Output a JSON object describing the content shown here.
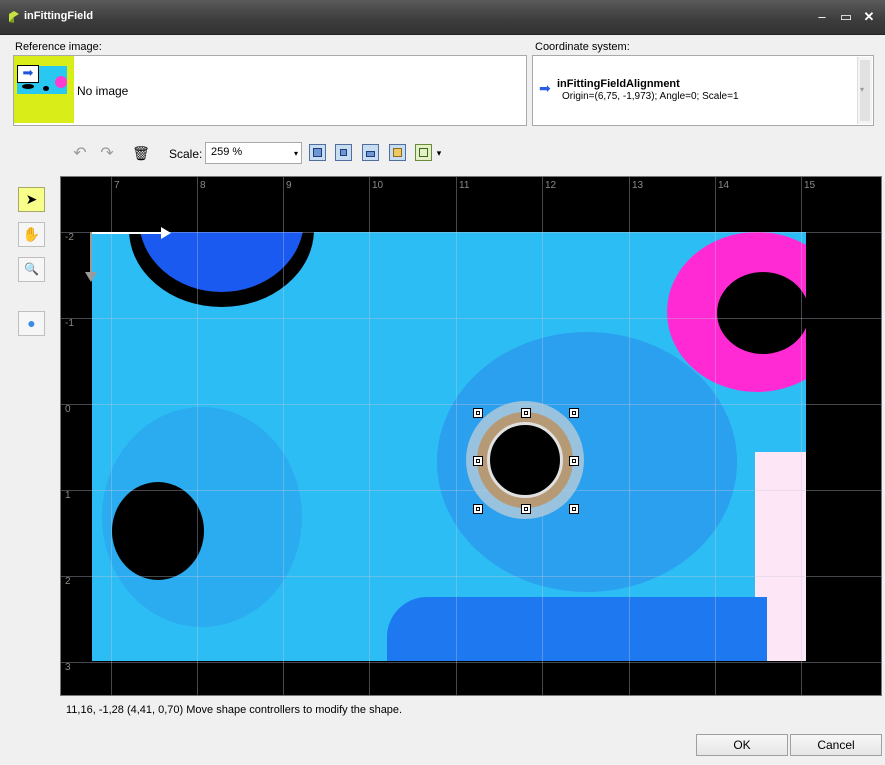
{
  "window": {
    "title": "inFittingField",
    "minimize_label": "–",
    "maximize_label": "▭",
    "close_label": "✕"
  },
  "reference": {
    "label": "Reference image:",
    "no_image": "No image"
  },
  "coordinate": {
    "label": "Coordinate system:",
    "name": "inFittingFieldAlignment",
    "detail": "Origin=(6,75, -1,973); Angle=0; Scale=1"
  },
  "toolbar": {
    "undo": "↶",
    "redo": "↷",
    "delete": "🗑",
    "scale_label": "Scale:",
    "scale_value": "259 %",
    "dropdown": "▾"
  },
  "tools": {
    "select": "➤",
    "pan": "✋",
    "zoom": "🔍",
    "circle": "●"
  },
  "ruler": {
    "x_ticks": [
      "7",
      "8",
      "9",
      "10",
      "11",
      "12",
      "13",
      "14",
      "15"
    ],
    "y_ticks": [
      "-2",
      "-1",
      "0",
      "1",
      "2",
      "3"
    ]
  },
  "status": "11,16, -1,28 (4,41, 0,70)  Move shape controllers to modify the shape.",
  "buttons": {
    "ok": "OK",
    "cancel": "Cancel"
  },
  "colors": {
    "accent_yellow": "#d9ee19",
    "image_cyan": "#2dbdf5",
    "magenta": "#ff2ad4",
    "deep_blue": "#1a5af0"
  }
}
